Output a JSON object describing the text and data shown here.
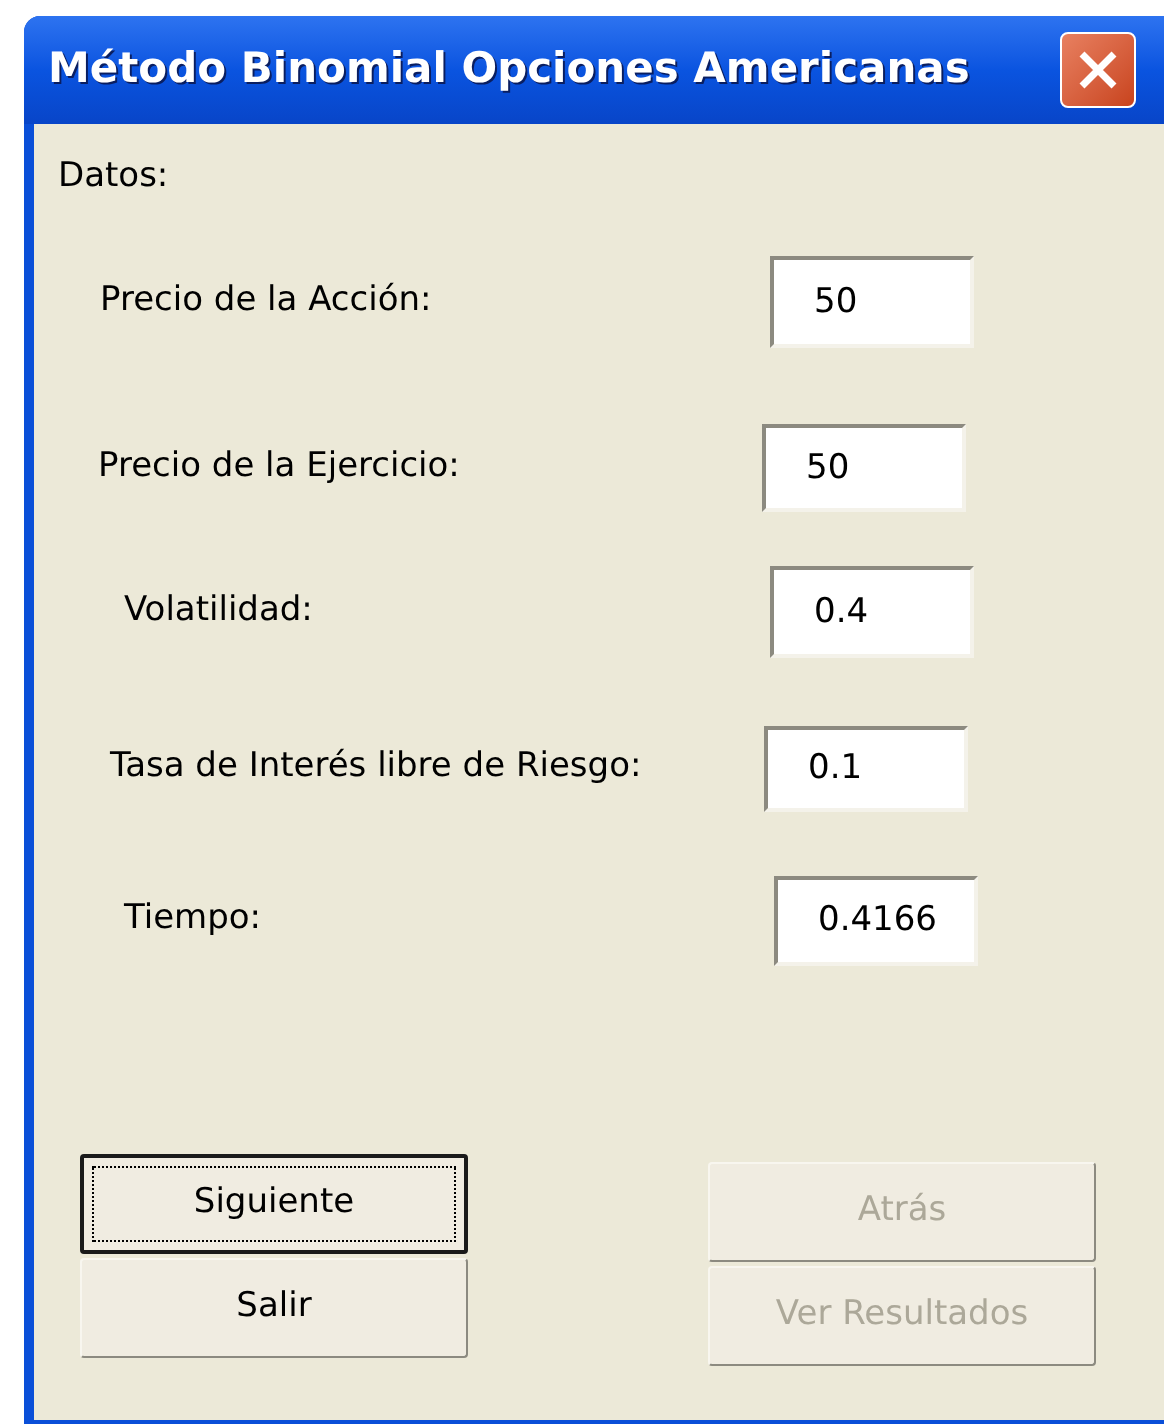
{
  "window": {
    "title": "Método Binomial Opciones Americanas"
  },
  "section_label": "Datos:",
  "fields": [
    {
      "label": "Precio de la Acción:",
      "value": "50"
    },
    {
      "label": "Precio de la Ejercicio:",
      "value": "50"
    },
    {
      "label": "Volatilidad:",
      "value": "0.4"
    },
    {
      "label": "Tasa de Interés libre de Riesgo:",
      "value": "0.1"
    },
    {
      "label": "Tiempo:",
      "value": "0.4166"
    }
  ],
  "buttons": [
    {
      "label": "Siguiente",
      "disabled": false,
      "default": true
    },
    {
      "label": "Salir",
      "disabled": false,
      "default": false
    },
    {
      "label": "Atrás",
      "disabled": true,
      "default": false
    },
    {
      "label": "Ver Resultados",
      "disabled": true,
      "default": false
    }
  ]
}
